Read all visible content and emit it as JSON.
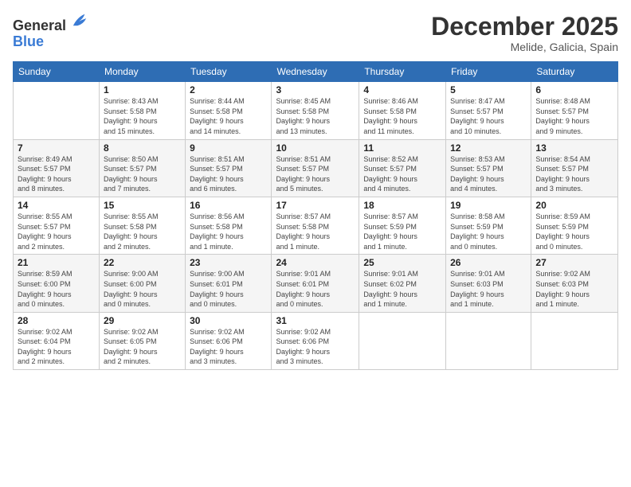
{
  "logo": {
    "general": "General",
    "blue": "Blue"
  },
  "title": "December 2025",
  "subtitle": "Melide, Galicia, Spain",
  "days_of_week": [
    "Sunday",
    "Monday",
    "Tuesday",
    "Wednesday",
    "Thursday",
    "Friday",
    "Saturday"
  ],
  "weeks": [
    [
      {
        "day": "",
        "info": ""
      },
      {
        "day": "1",
        "info": "Sunrise: 8:43 AM\nSunset: 5:58 PM\nDaylight: 9 hours\nand 15 minutes."
      },
      {
        "day": "2",
        "info": "Sunrise: 8:44 AM\nSunset: 5:58 PM\nDaylight: 9 hours\nand 14 minutes."
      },
      {
        "day": "3",
        "info": "Sunrise: 8:45 AM\nSunset: 5:58 PM\nDaylight: 9 hours\nand 13 minutes."
      },
      {
        "day": "4",
        "info": "Sunrise: 8:46 AM\nSunset: 5:58 PM\nDaylight: 9 hours\nand 11 minutes."
      },
      {
        "day": "5",
        "info": "Sunrise: 8:47 AM\nSunset: 5:57 PM\nDaylight: 9 hours\nand 10 minutes."
      },
      {
        "day": "6",
        "info": "Sunrise: 8:48 AM\nSunset: 5:57 PM\nDaylight: 9 hours\nand 9 minutes."
      }
    ],
    [
      {
        "day": "7",
        "info": "Sunrise: 8:49 AM\nSunset: 5:57 PM\nDaylight: 9 hours\nand 8 minutes."
      },
      {
        "day": "8",
        "info": "Sunrise: 8:50 AM\nSunset: 5:57 PM\nDaylight: 9 hours\nand 7 minutes."
      },
      {
        "day": "9",
        "info": "Sunrise: 8:51 AM\nSunset: 5:57 PM\nDaylight: 9 hours\nand 6 minutes."
      },
      {
        "day": "10",
        "info": "Sunrise: 8:51 AM\nSunset: 5:57 PM\nDaylight: 9 hours\nand 5 minutes."
      },
      {
        "day": "11",
        "info": "Sunrise: 8:52 AM\nSunset: 5:57 PM\nDaylight: 9 hours\nand 4 minutes."
      },
      {
        "day": "12",
        "info": "Sunrise: 8:53 AM\nSunset: 5:57 PM\nDaylight: 9 hours\nand 4 minutes."
      },
      {
        "day": "13",
        "info": "Sunrise: 8:54 AM\nSunset: 5:57 PM\nDaylight: 9 hours\nand 3 minutes."
      }
    ],
    [
      {
        "day": "14",
        "info": "Sunrise: 8:55 AM\nSunset: 5:57 PM\nDaylight: 9 hours\nand 2 minutes."
      },
      {
        "day": "15",
        "info": "Sunrise: 8:55 AM\nSunset: 5:58 PM\nDaylight: 9 hours\nand 2 minutes."
      },
      {
        "day": "16",
        "info": "Sunrise: 8:56 AM\nSunset: 5:58 PM\nDaylight: 9 hours\nand 1 minute."
      },
      {
        "day": "17",
        "info": "Sunrise: 8:57 AM\nSunset: 5:58 PM\nDaylight: 9 hours\nand 1 minute."
      },
      {
        "day": "18",
        "info": "Sunrise: 8:57 AM\nSunset: 5:59 PM\nDaylight: 9 hours\nand 1 minute."
      },
      {
        "day": "19",
        "info": "Sunrise: 8:58 AM\nSunset: 5:59 PM\nDaylight: 9 hours\nand 0 minutes."
      },
      {
        "day": "20",
        "info": "Sunrise: 8:59 AM\nSunset: 5:59 PM\nDaylight: 9 hours\nand 0 minutes."
      }
    ],
    [
      {
        "day": "21",
        "info": "Sunrise: 8:59 AM\nSunset: 6:00 PM\nDaylight: 9 hours\nand 0 minutes."
      },
      {
        "day": "22",
        "info": "Sunrise: 9:00 AM\nSunset: 6:00 PM\nDaylight: 9 hours\nand 0 minutes."
      },
      {
        "day": "23",
        "info": "Sunrise: 9:00 AM\nSunset: 6:01 PM\nDaylight: 9 hours\nand 0 minutes."
      },
      {
        "day": "24",
        "info": "Sunrise: 9:01 AM\nSunset: 6:01 PM\nDaylight: 9 hours\nand 0 minutes."
      },
      {
        "day": "25",
        "info": "Sunrise: 9:01 AM\nSunset: 6:02 PM\nDaylight: 9 hours\nand 1 minute."
      },
      {
        "day": "26",
        "info": "Sunrise: 9:01 AM\nSunset: 6:03 PM\nDaylight: 9 hours\nand 1 minute."
      },
      {
        "day": "27",
        "info": "Sunrise: 9:02 AM\nSunset: 6:03 PM\nDaylight: 9 hours\nand 1 minute."
      }
    ],
    [
      {
        "day": "28",
        "info": "Sunrise: 9:02 AM\nSunset: 6:04 PM\nDaylight: 9 hours\nand 2 minutes."
      },
      {
        "day": "29",
        "info": "Sunrise: 9:02 AM\nSunset: 6:05 PM\nDaylight: 9 hours\nand 2 minutes."
      },
      {
        "day": "30",
        "info": "Sunrise: 9:02 AM\nSunset: 6:06 PM\nDaylight: 9 hours\nand 3 minutes."
      },
      {
        "day": "31",
        "info": "Sunrise: 9:02 AM\nSunset: 6:06 PM\nDaylight: 9 hours\nand 3 minutes."
      },
      {
        "day": "",
        "info": ""
      },
      {
        "day": "",
        "info": ""
      },
      {
        "day": "",
        "info": ""
      }
    ]
  ]
}
